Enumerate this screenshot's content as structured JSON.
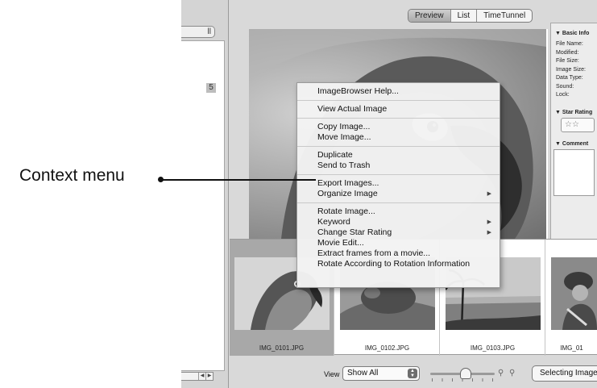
{
  "callout": {
    "label": "Context menu"
  },
  "left_panel": {
    "tab_label": "ll",
    "badge": "5"
  },
  "view_tabs": [
    {
      "label": "Preview",
      "active": true
    },
    {
      "label": "List",
      "active": false
    },
    {
      "label": "TimeTunnel",
      "active": false
    }
  ],
  "info_panel": {
    "basic_header": "Basic Info",
    "rows": [
      "File Name:",
      "Modified:",
      "File Size:",
      "Image Size:",
      "Data Type:",
      "Sound:",
      "Lock:"
    ],
    "star_header": "Star Rating",
    "stars": "☆☆",
    "comment_header": "Comment"
  },
  "context_menu": {
    "groups": [
      [
        {
          "label": "ImageBrowser Help..."
        }
      ],
      [
        {
          "label": "View Actual Image"
        }
      ],
      [
        {
          "label": "Copy Image..."
        },
        {
          "label": "Move Image..."
        }
      ],
      [
        {
          "label": "Duplicate"
        },
        {
          "label": "Send to Trash"
        }
      ],
      [
        {
          "label": "Export Images..."
        },
        {
          "label": "Organize Image",
          "submenu": true
        }
      ],
      [
        {
          "label": "Rotate Image..."
        },
        {
          "label": "Keyword",
          "submenu": true
        },
        {
          "label": "Change Star Rating",
          "submenu": true
        },
        {
          "label": "Movie Edit..."
        },
        {
          "label": "Extract frames from a movie..."
        },
        {
          "label": "Rotate According to Rotation Information"
        }
      ]
    ]
  },
  "thumbnails": [
    {
      "label": "IMG_0101.JPG",
      "selected": true
    },
    {
      "label": "IMG_0102.JPG",
      "selected": false
    },
    {
      "label": "IMG_0103.JPG",
      "selected": false
    },
    {
      "label": "IMG_01",
      "selected": false
    }
  ],
  "bottom_bar": {
    "view_label": "View",
    "view_select": "Show All",
    "selecting_button": "Selecting Images"
  }
}
